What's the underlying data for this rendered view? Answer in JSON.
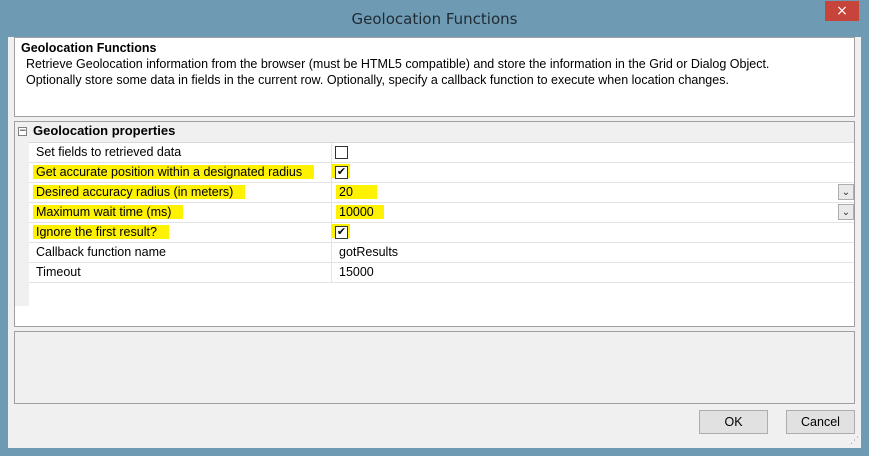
{
  "window": {
    "title": "Geolocation Functions",
    "close_label": "×"
  },
  "description": {
    "title": "Geolocation Functions",
    "lines": [
      "Retrieve Geolocation information from the browser (must be HTML5 compatible) and store the information in the Grid or Dialog Object.",
      "Optionally store some data in fields in the current row. Optionally, specify a callback function to execute when location changes."
    ]
  },
  "grid": {
    "category": "Geolocation properties",
    "collapse_glyph": "−",
    "rows": [
      {
        "label": "Set fields to retrieved data",
        "value": "",
        "type": "checkbox",
        "checked": false,
        "highlight": false
      },
      {
        "label": "Get accurate position within a designated radius",
        "value": "",
        "type": "checkbox",
        "checked": true,
        "highlight": true
      },
      {
        "label": "Desired accuracy radius (in meters)",
        "value": "20",
        "type": "dropdown",
        "highlight": true
      },
      {
        "label": "Maximum wait time (ms)",
        "value": "10000",
        "type": "dropdown",
        "highlight": true
      },
      {
        "label": "Ignore the first result?",
        "value": "",
        "type": "checkbox",
        "checked": true,
        "highlight": true
      },
      {
        "label": "Callback function name",
        "value": "gotResults",
        "type": "text",
        "highlight": false
      },
      {
        "label": "Timeout",
        "value": "15000",
        "type": "text",
        "highlight": false
      }
    ]
  },
  "buttons": {
    "ok": "OK",
    "cancel": "Cancel"
  },
  "colors": {
    "highlight": "#fff200",
    "frame": "#6e9ab3",
    "close": "#c7443a"
  }
}
